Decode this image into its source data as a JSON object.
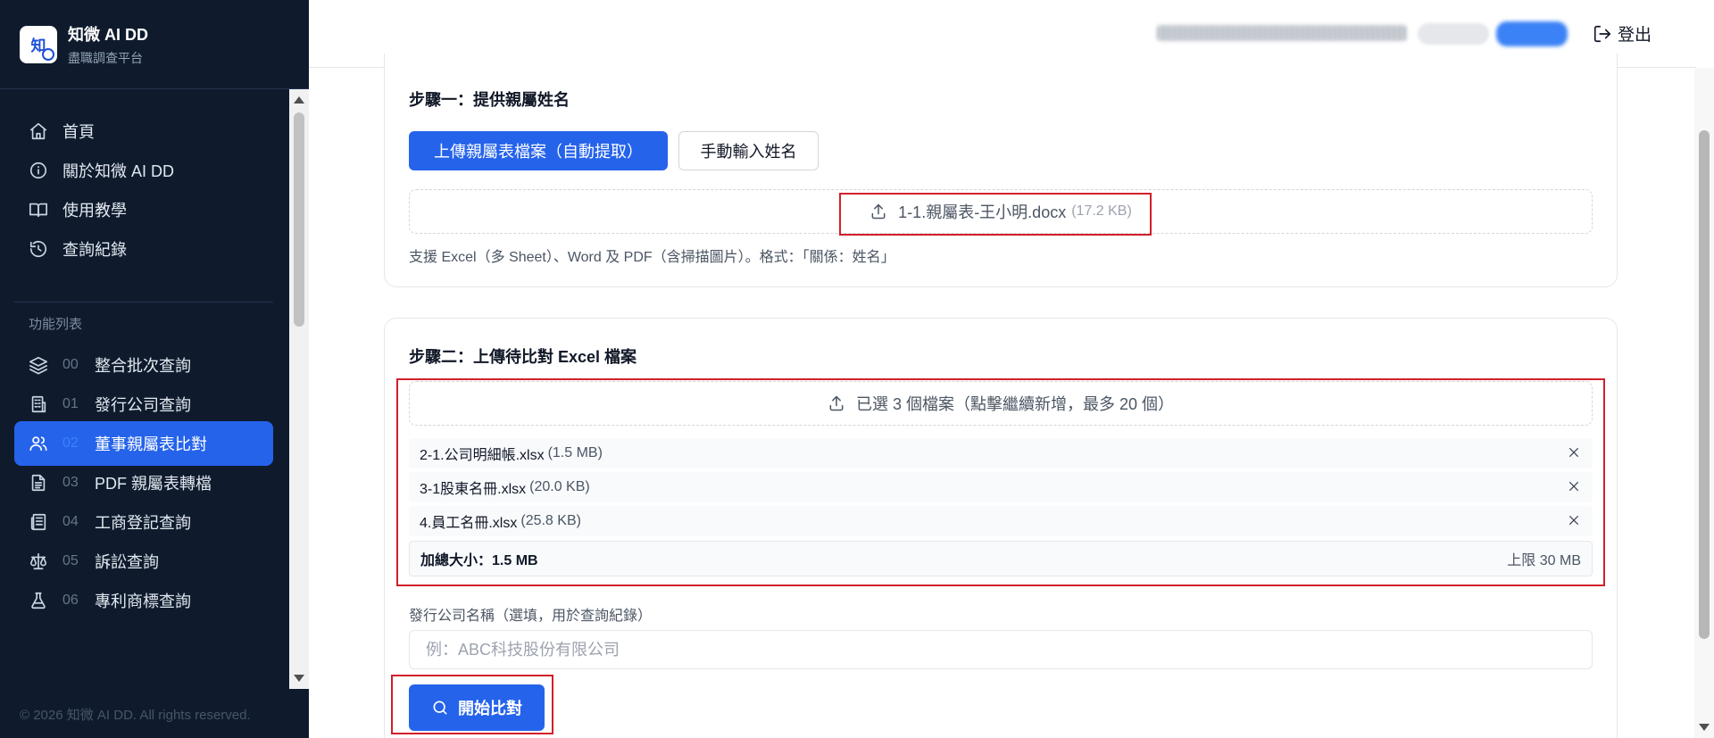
{
  "brand": {
    "title": "知微 AI DD",
    "subtitle": "盡職調查平台",
    "logo_char": "知"
  },
  "nav": {
    "items": [
      {
        "label": "首頁",
        "icon": "home-icon"
      },
      {
        "label": "關於知微 AI DD",
        "icon": "info-icon"
      },
      {
        "label": "使用教學",
        "icon": "book-icon"
      },
      {
        "label": "查詢紀錄",
        "icon": "history-icon"
      }
    ],
    "section_label": "功能列表",
    "features": [
      {
        "num": "00",
        "label": "整合批次查詢",
        "icon": "layers-icon"
      },
      {
        "num": "01",
        "label": "發行公司查詢",
        "icon": "building-icon"
      },
      {
        "num": "02",
        "label": "董事親屬表比對",
        "icon": "users-icon",
        "active": true
      },
      {
        "num": "03",
        "label": "PDF 親屬表轉檔",
        "icon": "file-text-icon"
      },
      {
        "num": "04",
        "label": "工商登記查詢",
        "icon": "newspaper-icon"
      },
      {
        "num": "05",
        "label": "訴訟查詢",
        "icon": "scale-icon"
      },
      {
        "num": "06",
        "label": "專利商標查詢",
        "icon": "flask-icon"
      }
    ]
  },
  "footer": {
    "copyright": "© 2026 知微 AI DD. All rights reserved."
  },
  "header": {
    "logout_label": "登出"
  },
  "step1": {
    "title": "步驟一：提供親屬姓名",
    "upload_button": "上傳親屬表檔案（自動提取）",
    "manual_button": "手動輸入姓名",
    "file_name": "1-1.親屬表-王小明.docx",
    "file_size": "(17.2 KB)",
    "hint": "支援 Excel（多 Sheet）、Word 及 PDF（含掃描圖片）。格式：「關係：姓名」"
  },
  "step2": {
    "title": "步驟二：上傳待比對 Excel 檔案",
    "dropzone_text": "已選 3 個檔案（點擊繼續新增，最多 20 個）",
    "files": [
      {
        "name": "2-1.公司明細帳.xlsx",
        "size": "(1.5 MB)"
      },
      {
        "name": "3-1股東名冊.xlsx",
        "size": "(20.0 KB)"
      },
      {
        "name": "4.員工名冊.xlsx",
        "size": "(25.8 KB)"
      }
    ],
    "total_label": "加總大小：1.5 MB",
    "limit_label": "上限 30 MB",
    "company_label": "發行公司名稱（選填，用於查詢紀錄）",
    "company_placeholder": "例：ABC科技股份有限公司",
    "company_value": "",
    "start_button": "開始比對"
  },
  "colors": {
    "primary": "#2563eb",
    "sidebar_bg": "#0f1b2d",
    "highlight_red": "#d11f2a"
  }
}
